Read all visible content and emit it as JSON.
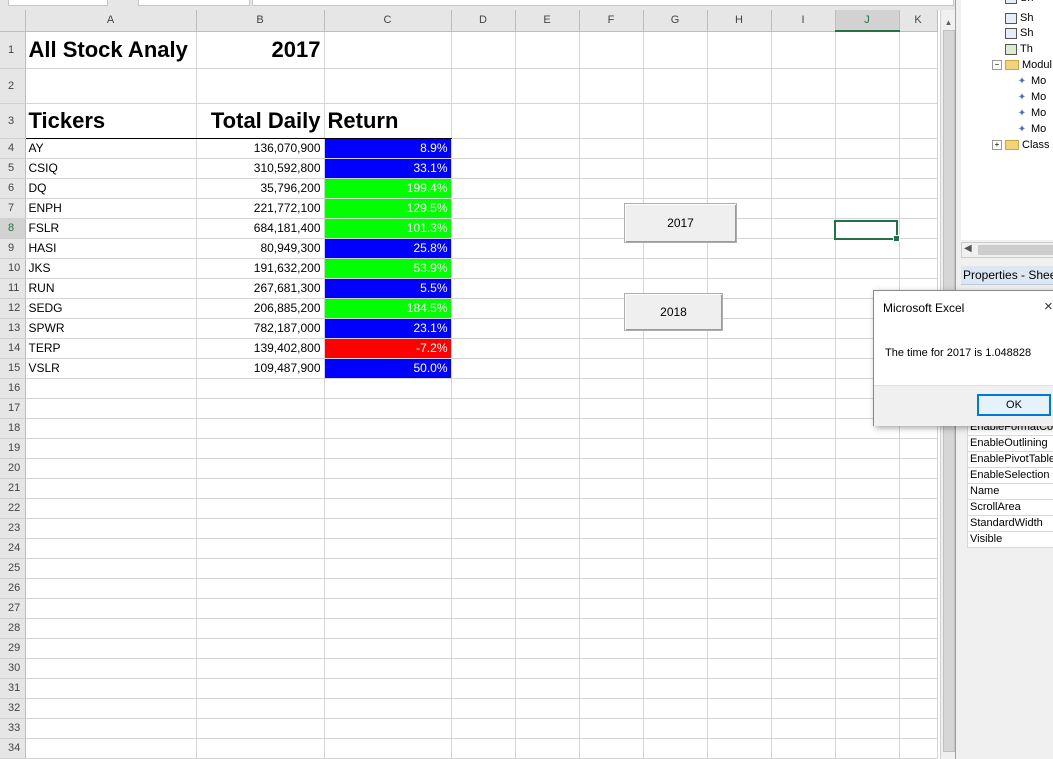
{
  "columns": [
    "A",
    "B",
    "C",
    "D",
    "E",
    "F",
    "G",
    "H",
    "I",
    "J",
    "K"
  ],
  "rows": [
    {
      "n": "1",
      "a": "All Stock Analy",
      "b": "2017",
      "c": "",
      "style": "title"
    },
    {
      "n": "2",
      "a": "",
      "b": "",
      "c": "",
      "style": "blank2"
    },
    {
      "n": "3",
      "a": "Tickers",
      "b": "Total Daily",
      "c": "Return",
      "style": "header"
    },
    {
      "n": "4",
      "a": "AY",
      "b": "136,070,900",
      "c": "8.9%",
      "fill": "#0000ff"
    },
    {
      "n": "5",
      "a": "CSIQ",
      "b": "310,592,800",
      "c": "33.1%",
      "fill": "#0000ff"
    },
    {
      "n": "6",
      "a": "DQ",
      "b": "35,796,200",
      "c": "199.4%",
      "fill": "#00ff00"
    },
    {
      "n": "7",
      "a": "ENPH",
      "b": "221,772,100",
      "c": "129.5%",
      "fill": "#00ff00"
    },
    {
      "n": "8",
      "a": "FSLR",
      "b": "684,181,400",
      "c": "101.3%",
      "fill": "#00ff00"
    },
    {
      "n": "9",
      "a": "HASI",
      "b": "80,949,300",
      "c": "25.8%",
      "fill": "#0000ff"
    },
    {
      "n": "10",
      "a": "JKS",
      "b": "191,632,200",
      "c": "53.9%",
      "fill": "#00ff00"
    },
    {
      "n": "11",
      "a": "RUN",
      "b": "267,681,300",
      "c": "5.5%",
      "fill": "#0000ff"
    },
    {
      "n": "12",
      "a": "SEDG",
      "b": "206,885,200",
      "c": "184.5%",
      "fill": "#00ff00"
    },
    {
      "n": "13",
      "a": "SPWR",
      "b": "782,187,000",
      "c": "23.1%",
      "fill": "#0000ff"
    },
    {
      "n": "14",
      "a": "TERP",
      "b": "139,402,800",
      "c": "-7.2%",
      "fill": "#ff0000"
    },
    {
      "n": "15",
      "a": "VSLR",
      "b": "109,487,900",
      "c": "50.0%",
      "fill": "#0000ff"
    },
    {
      "n": "16"
    },
    {
      "n": "17"
    },
    {
      "n": "18"
    },
    {
      "n": "19"
    },
    {
      "n": "20"
    },
    {
      "n": "21"
    },
    {
      "n": "22"
    },
    {
      "n": "23"
    },
    {
      "n": "24"
    },
    {
      "n": "25"
    },
    {
      "n": "26"
    },
    {
      "n": "27"
    },
    {
      "n": "28"
    },
    {
      "n": "29"
    },
    {
      "n": "30"
    },
    {
      "n": "31"
    },
    {
      "n": "32"
    },
    {
      "n": "33"
    },
    {
      "n": "34"
    }
  ],
  "buttons": {
    "btn2017": "2017",
    "btn2018": "2018"
  },
  "vba_tree": [
    "Sh",
    "Sh",
    "Sh",
    "Th",
    "Modul",
    "Mo",
    "Mo",
    "Mo",
    "Mo",
    "Class I"
  ],
  "properties_title": "Properties - Sheet",
  "properties": [
    "EnableFormatCon",
    "EnableOutlining",
    "EnablePivotTable",
    "EnableSelection",
    "Name",
    "ScrollArea",
    "StandardWidth",
    "Visible"
  ],
  "dialog": {
    "title": "Microsoft Excel",
    "close": "×",
    "message": "The time for 2017 is 1.048828",
    "ok": "OK"
  },
  "colors": {
    "selection": "#217346",
    "positive": "#00ff00",
    "low": "#0000ff",
    "negative": "#ff0000"
  }
}
